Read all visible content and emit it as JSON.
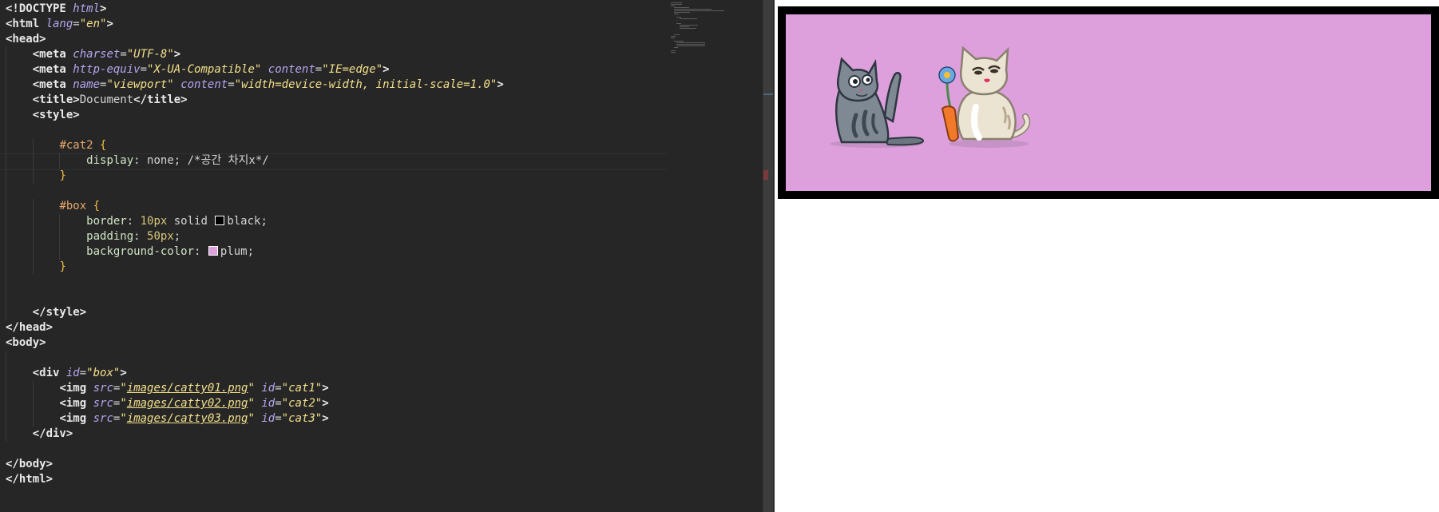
{
  "editor": {
    "lines": [
      [
        {
          "c": "tag",
          "t": "<!DOCTYPE "
        },
        {
          "c": "attr",
          "t": "html"
        },
        {
          "c": "tag",
          "t": ">"
        }
      ],
      [
        {
          "c": "tag",
          "t": "<html "
        },
        {
          "c": "attr",
          "t": "lang"
        },
        {
          "c": "val",
          "t": "="
        },
        {
          "c": "str",
          "t": "\"en\""
        },
        {
          "c": "tag",
          "t": ">"
        }
      ],
      [
        {
          "c": "tag",
          "t": "<head>"
        }
      ],
      [
        {
          "c": "ind",
          "n": 1
        },
        {
          "c": "tag",
          "t": "<meta "
        },
        {
          "c": "attr",
          "t": "charset"
        },
        {
          "c": "val",
          "t": "="
        },
        {
          "c": "str",
          "t": "\"UTF-8\""
        },
        {
          "c": "tag",
          "t": ">"
        }
      ],
      [
        {
          "c": "ind",
          "n": 1
        },
        {
          "c": "tag",
          "t": "<meta "
        },
        {
          "c": "attr",
          "t": "http-equiv"
        },
        {
          "c": "val",
          "t": "="
        },
        {
          "c": "str",
          "t": "\"X-UA-Compatible\""
        },
        {
          "c": "val",
          "t": " "
        },
        {
          "c": "attr",
          "t": "content"
        },
        {
          "c": "val",
          "t": "="
        },
        {
          "c": "str",
          "t": "\"IE=edge\""
        },
        {
          "c": "tag",
          "t": ">"
        }
      ],
      [
        {
          "c": "ind",
          "n": 1
        },
        {
          "c": "tag",
          "t": "<meta "
        },
        {
          "c": "attr",
          "t": "name"
        },
        {
          "c": "val",
          "t": "="
        },
        {
          "c": "str",
          "t": "\"viewport\""
        },
        {
          "c": "val",
          "t": " "
        },
        {
          "c": "attr",
          "t": "content"
        },
        {
          "c": "val",
          "t": "="
        },
        {
          "c": "str",
          "t": "\"width=device-width, initial-scale=1.0\""
        },
        {
          "c": "tag",
          "t": ">"
        }
      ],
      [
        {
          "c": "ind",
          "n": 1
        },
        {
          "c": "tag",
          "t": "<title>"
        },
        {
          "c": "val",
          "t": "Document"
        },
        {
          "c": "tag",
          "t": "</title>"
        }
      ],
      [
        {
          "c": "ind",
          "n": 1
        },
        {
          "c": "tag",
          "t": "<style>"
        }
      ],
      [
        {
          "c": "ind",
          "n": 1
        }
      ],
      [
        {
          "c": "ind",
          "n": 2
        },
        {
          "c": "sel",
          "t": "#cat2 "
        },
        {
          "c": "brace",
          "t": "{"
        }
      ],
      [
        {
          "c": "ind",
          "n": 3
        },
        {
          "c": "prop",
          "t": "display"
        },
        {
          "c": "val",
          "t": ": none; "
        },
        {
          "c": "cmt",
          "t": "/*공간 차지x*/"
        }
      ],
      [
        {
          "c": "ind",
          "n": 2
        },
        {
          "c": "brace",
          "t": "}"
        }
      ],
      [
        {
          "c": "ind",
          "n": 1
        }
      ],
      [
        {
          "c": "ind",
          "n": 2
        },
        {
          "c": "sel",
          "t": "#box "
        },
        {
          "c": "brace",
          "t": "{"
        }
      ],
      [
        {
          "c": "ind",
          "n": 3
        },
        {
          "c": "prop",
          "t": "border"
        },
        {
          "c": "val",
          "t": ": "
        },
        {
          "c": "num",
          "t": "10px"
        },
        {
          "c": "val",
          "t": " solid "
        },
        {
          "c": "sw",
          "color": "#000000"
        },
        {
          "c": "val",
          "t": "black;"
        }
      ],
      [
        {
          "c": "ind",
          "n": 3
        },
        {
          "c": "prop",
          "t": "padding"
        },
        {
          "c": "val",
          "t": ": "
        },
        {
          "c": "num",
          "t": "50px"
        },
        {
          "c": "val",
          "t": ";"
        }
      ],
      [
        {
          "c": "ind",
          "n": 3
        },
        {
          "c": "prop",
          "t": "background-color"
        },
        {
          "c": "val",
          "t": ": "
        },
        {
          "c": "sw",
          "color": "#dda0dd"
        },
        {
          "c": "val",
          "t": "plum;"
        }
      ],
      [
        {
          "c": "ind",
          "n": 2
        },
        {
          "c": "brace",
          "t": "}"
        }
      ],
      [
        {
          "c": "ind",
          "n": 1
        }
      ],
      [
        {
          "c": "ind",
          "n": 1
        }
      ],
      [
        {
          "c": "ind",
          "n": 1
        },
        {
          "c": "tag",
          "t": "</style>"
        }
      ],
      [
        {
          "c": "tag",
          "t": "</head>"
        }
      ],
      [
        {
          "c": "tag",
          "t": "<body>"
        }
      ],
      [
        {
          "c": "ind",
          "n": 1
        }
      ],
      [
        {
          "c": "ind",
          "n": 1
        },
        {
          "c": "tag",
          "t": "<div "
        },
        {
          "c": "attr",
          "t": "id"
        },
        {
          "c": "val",
          "t": "="
        },
        {
          "c": "str",
          "t": "\"box\""
        },
        {
          "c": "tag",
          "t": ">"
        }
      ],
      [
        {
          "c": "ind",
          "n": 2
        },
        {
          "c": "tag",
          "t": "<img "
        },
        {
          "c": "attr",
          "t": "src"
        },
        {
          "c": "val",
          "t": "="
        },
        {
          "c": "str",
          "t": "\""
        },
        {
          "c": "url",
          "t": "images/catty01.png"
        },
        {
          "c": "str",
          "t": "\""
        },
        {
          "c": "val",
          "t": " "
        },
        {
          "c": "attr",
          "t": "id"
        },
        {
          "c": "val",
          "t": "="
        },
        {
          "c": "str",
          "t": "\"cat1\""
        },
        {
          "c": "tag",
          "t": ">"
        }
      ],
      [
        {
          "c": "ind",
          "n": 2
        },
        {
          "c": "tag",
          "t": "<img "
        },
        {
          "c": "attr",
          "t": "src"
        },
        {
          "c": "val",
          "t": "="
        },
        {
          "c": "str",
          "t": "\""
        },
        {
          "c": "url",
          "t": "images/catty02.png"
        },
        {
          "c": "str",
          "t": "\""
        },
        {
          "c": "val",
          "t": " "
        },
        {
          "c": "attr",
          "t": "id"
        },
        {
          "c": "val",
          "t": "="
        },
        {
          "c": "str",
          "t": "\"cat2\""
        },
        {
          "c": "tag",
          "t": ">"
        }
      ],
      [
        {
          "c": "ind",
          "n": 2
        },
        {
          "c": "tag",
          "t": "<img "
        },
        {
          "c": "attr",
          "t": "src"
        },
        {
          "c": "val",
          "t": "="
        },
        {
          "c": "str",
          "t": "\""
        },
        {
          "c": "url",
          "t": "images/catty03.png"
        },
        {
          "c": "str",
          "t": "\""
        },
        {
          "c": "val",
          "t": " "
        },
        {
          "c": "attr",
          "t": "id"
        },
        {
          "c": "val",
          "t": "="
        },
        {
          "c": "str",
          "t": "\"cat3\""
        },
        {
          "c": "tag",
          "t": ">"
        }
      ],
      [
        {
          "c": "ind",
          "n": 1
        },
        {
          "c": "tag",
          "t": "</div>"
        }
      ],
      [],
      [
        {
          "c": "tag",
          "t": "</body>"
        }
      ],
      [
        {
          "c": "tag",
          "t": "</html>"
        }
      ]
    ]
  },
  "preview": {
    "box_color": "#dda0dd",
    "border_color": "#000000",
    "images": [
      {
        "id": "cat1",
        "icon": "gray-cat-illustration"
      },
      {
        "id": "cat3",
        "icon": "cream-cat-with-flower-illustration"
      }
    ]
  },
  "colors": {
    "editor_bg": "#262626",
    "preview_bg": "#ffffff"
  }
}
